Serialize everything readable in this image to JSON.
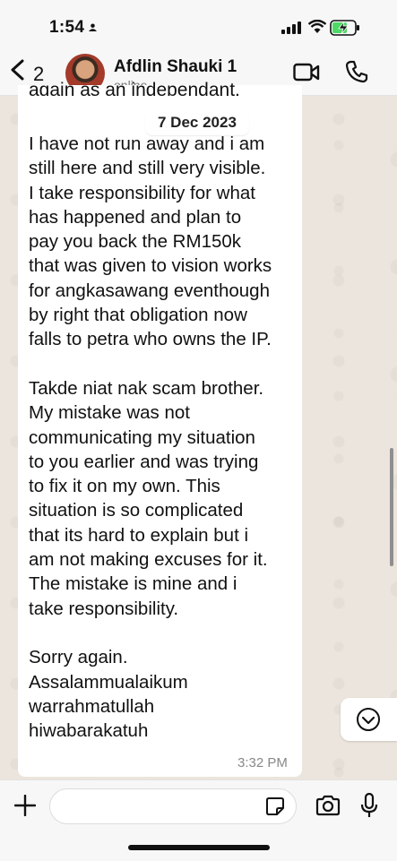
{
  "status_bar": {
    "time": "1:54"
  },
  "header": {
    "back_count": "2",
    "contact_name": "Afdlin Shauki 1",
    "contact_status": "online"
  },
  "chat": {
    "clipped_previous_line": "again as an independant.",
    "date_separator": "7 Dec 2023",
    "message": {
      "text": "I have not run away and i am\nstill here and still very visible.\nI take responsibility for what\nhas happened and plan to\npay you back the RM150k\nthat was given to vision works\nfor angkasawang eventhough\nby right that obligation now\nfalls to petra who owns the IP.\n\nTakde niat nak scam brother.\nMy mistake was not\ncommunicating my situation\nto you earlier and was trying\nto fix it on my own. This\nsituation is so complicated\nthat its hard to explain but i\nam not making excuses for it.\nThe mistake is mine and i\ntake responsibility.\n\nSorry again.\nAssalammualaikum\nwarrahmatullah\nhiwabarakatuh",
      "time": "3:32 PM"
    }
  },
  "colors": {
    "battery_fill": "#4cd964",
    "wallpaper": "#ece5dd",
    "bubble": "#ffffff"
  },
  "icons": [
    "person-icon",
    "signal-icon",
    "wifi-icon",
    "battery-charging-icon",
    "back-chevron-icon",
    "video-call-icon",
    "phone-icon",
    "chevron-down-icon",
    "plus-icon",
    "sticker-icon",
    "camera-icon",
    "microphone-icon"
  ]
}
